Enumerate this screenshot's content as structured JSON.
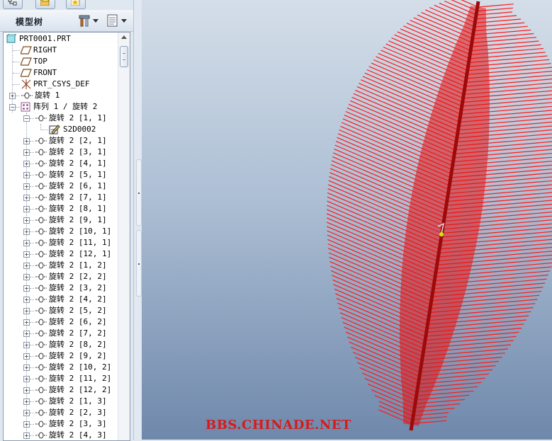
{
  "panel": {
    "title": "模型树"
  },
  "tree": {
    "root": "PRT0001.PRT",
    "datums": [
      "RIGHT",
      "TOP",
      "FRONT",
      "PRT_CSYS_DEF"
    ],
    "feature1": "旋转 1",
    "pattern": "阵列 1 / 旋转 2",
    "pattern_first": "旋转 2 [1, 1]",
    "sketch": "S2D0002",
    "instances": [
      "旋转 2 [2, 1]",
      "旋转 2 [3, 1]",
      "旋转 2 [4, 1]",
      "旋转 2 [5, 1]",
      "旋转 2 [6, 1]",
      "旋转 2 [7, 1]",
      "旋转 2 [8, 1]",
      "旋转 2 [9, 1]",
      "旋转 2 [10, 1]",
      "旋转 2 [11, 1]",
      "旋转 2 [12, 1]",
      "旋转 2 [1, 2]",
      "旋转 2 [2, 2]",
      "旋转 2 [3, 2]",
      "旋转 2 [4, 2]",
      "旋转 2 [5, 2]",
      "旋转 2 [6, 2]",
      "旋转 2 [7, 2]",
      "旋转 2 [8, 2]",
      "旋转 2 [9, 2]",
      "旋转 2 [10, 2]",
      "旋转 2 [11, 2]",
      "旋转 2 [12, 2]",
      "旋转 2 [1, 3]",
      "旋转 2 [2, 3]",
      "旋转 2 [3, 3]",
      "旋转 2 [4, 3]"
    ]
  },
  "viewport": {
    "watermark": "BBS.CHINADE.NET",
    "model_color": "#ff1a1a",
    "background_top": "#d4dee9",
    "background_bottom": "#6f88ab"
  },
  "icons": {
    "tab1": "model-tree-tab-icon",
    "tab2": "folder-tab-icon",
    "tab3": "favorites-tab-icon",
    "settings": "tools-icon",
    "show": "show-list-icon"
  }
}
